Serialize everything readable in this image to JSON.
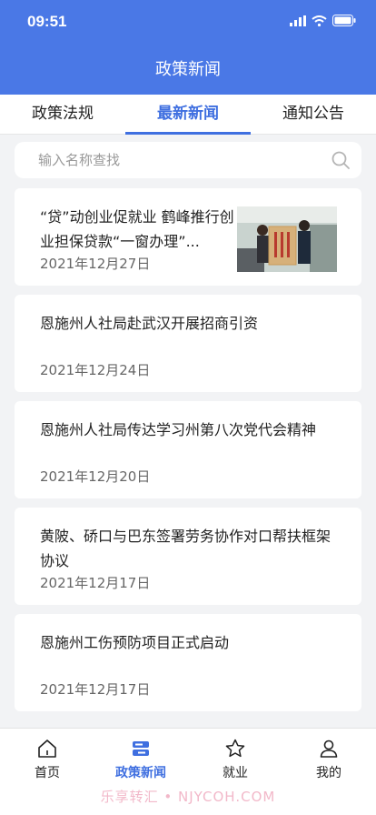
{
  "status_bar": {
    "time": "09:51"
  },
  "nav": {
    "title": "政策新闻"
  },
  "tabs": [
    {
      "label": "政策法规"
    },
    {
      "label": "最新新闻",
      "active": true
    },
    {
      "label": "通知公告"
    }
  ],
  "search": {
    "placeholder": "输入名称查找",
    "value": ""
  },
  "news": [
    {
      "title": "“贷”动创业促就业 鹤峰推行创业担保贷款“一窗办理”...",
      "date": "2021年12月27日",
      "has_thumbnail": true
    },
    {
      "title": "恩施州人社局赴武汉开展招商引资",
      "date": "2021年12月24日"
    },
    {
      "title": "恩施州人社局传达学习州第八次党代会精神",
      "date": "2021年12月20日"
    },
    {
      "title": "黄陂、硚口与巴东签署劳务协作对口帮扶框架协议",
      "date": "2021年12月17日"
    },
    {
      "title": "恩施州工伤预防项目正式启动",
      "date": "2021年12月17日"
    }
  ],
  "bottom_nav": [
    {
      "label": "首页",
      "icon": "home-icon"
    },
    {
      "label": "政策新闻",
      "icon": "news-icon",
      "active": true
    },
    {
      "label": "就业",
      "icon": "star-icon"
    },
    {
      "label": "我的",
      "icon": "user-icon"
    }
  ],
  "watermark": "乐享转汇 • NJYCOH.COM",
  "colors": {
    "primary": "#4a78e6",
    "active": "#3f6fe0",
    "background": "#f2f3f5"
  }
}
